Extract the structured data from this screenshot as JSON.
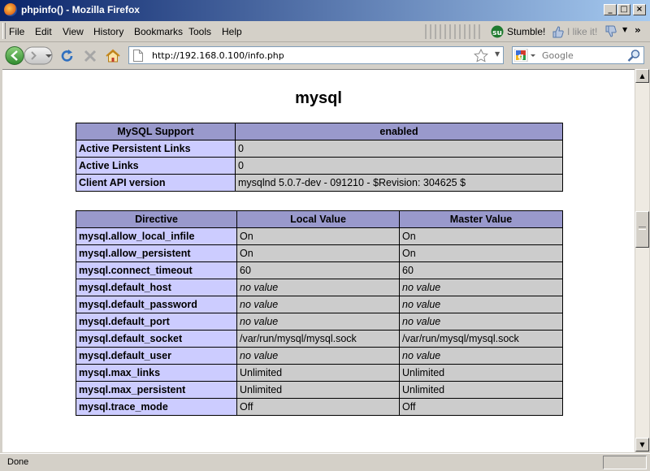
{
  "window": {
    "title": "phpinfo() - Mozilla Firefox"
  },
  "menu": [
    "File",
    "Edit",
    "View",
    "History",
    "Bookmarks",
    "Tools",
    "Help"
  ],
  "toolbar": {
    "stumble_label": "Stumble!",
    "like_label": "I like it!"
  },
  "nav": {
    "url": "http://192.168.0.100/info.php",
    "search_placeholder": "Google"
  },
  "page": {
    "heading": "mysql",
    "support_table": {
      "headers": [
        "MySQL Support",
        "enabled"
      ],
      "rows": [
        [
          "Active Persistent Links",
          "0"
        ],
        [
          "Active Links",
          "0"
        ],
        [
          "Client API version",
          "mysqlnd 5.0.7-dev - 091210 - $Revision: 304625 $"
        ]
      ]
    },
    "directive_table": {
      "headers": [
        "Directive",
        "Local Value",
        "Master Value"
      ],
      "rows": [
        [
          "mysql.allow_local_infile",
          "On",
          "On"
        ],
        [
          "mysql.allow_persistent",
          "On",
          "On"
        ],
        [
          "mysql.connect_timeout",
          "60",
          "60"
        ],
        [
          "mysql.default_host",
          "no value",
          "no value"
        ],
        [
          "mysql.default_password",
          "no value",
          "no value"
        ],
        [
          "mysql.default_port",
          "no value",
          "no value"
        ],
        [
          "mysql.default_socket",
          "/var/run/mysql/mysql.sock",
          "/var/run/mysql/mysql.sock"
        ],
        [
          "mysql.default_user",
          "no value",
          "no value"
        ],
        [
          "mysql.max_links",
          "Unlimited",
          "Unlimited"
        ],
        [
          "mysql.max_persistent",
          "Unlimited",
          "Unlimited"
        ],
        [
          "mysql.trace_mode",
          "Off",
          "Off"
        ]
      ]
    }
  },
  "status": {
    "text": "Done"
  }
}
